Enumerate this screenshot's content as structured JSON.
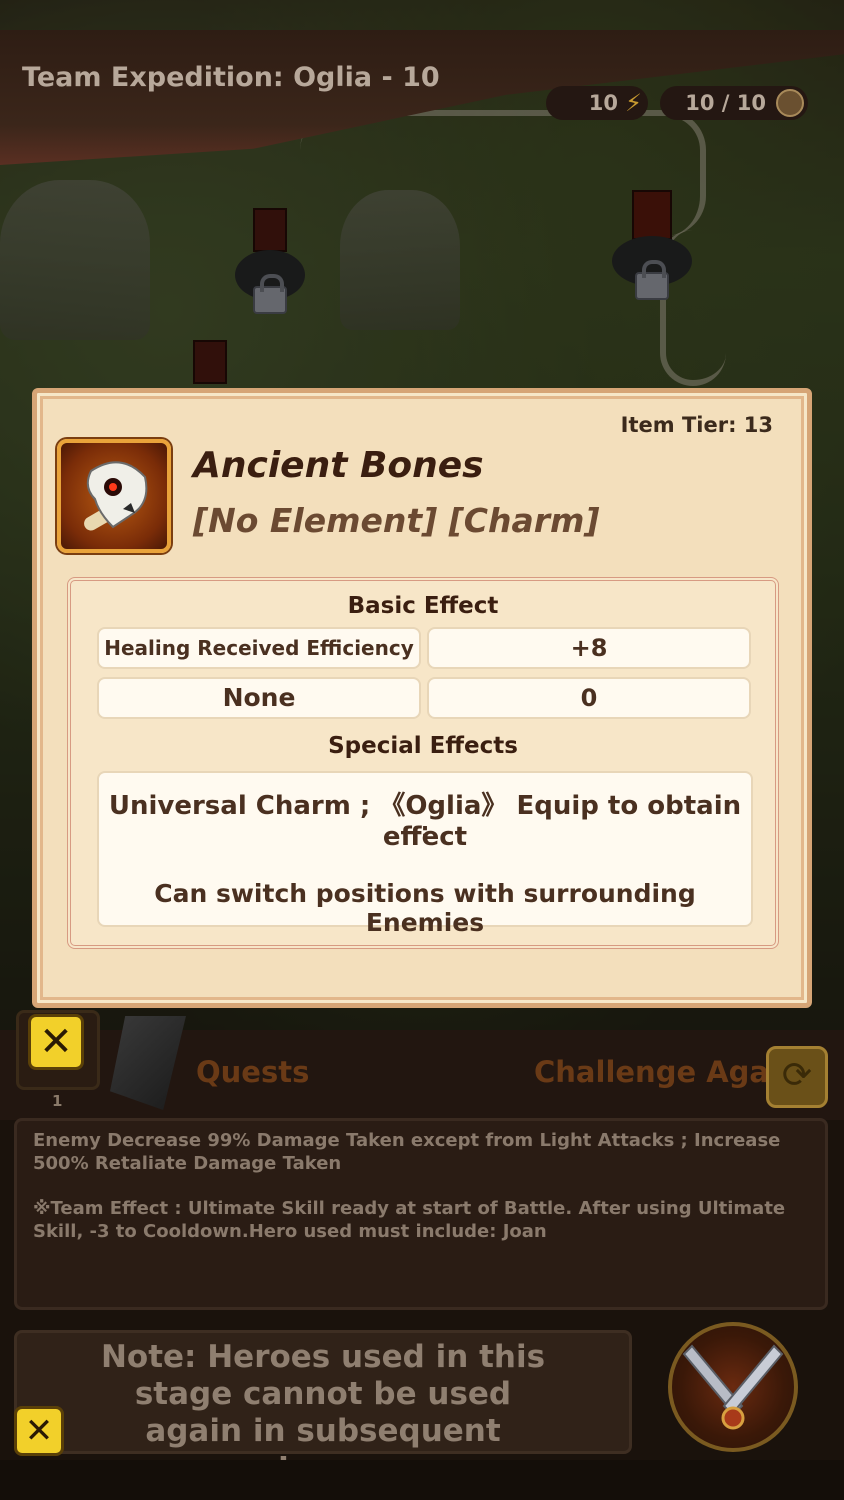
{
  "header": {
    "title": "Team Expedition: Oglia - 10",
    "stamina": "10",
    "attempts": "10 / 10"
  },
  "modal": {
    "item_tier": "Item Tier: 13",
    "item_name": "Ancient Bones",
    "item_type": "[No Element] [Charm]",
    "basic_effect_title": "Basic Effect",
    "basic_effects": [
      {
        "name": "Healing Received Efficiency %",
        "value": "+8"
      },
      {
        "name": "None",
        "value": "0"
      }
    ],
    "special_effects_title": "Special Effects",
    "special_line1": "Universal Charm ; 《Oglia》 Equip to obtain effect",
    "special_line2": ":",
    "special_line3": "Can switch positions with surrounding Enemies"
  },
  "bottom": {
    "quests_label": "Quests",
    "challenge_again_label": "Challenge Again",
    "slot_count": "1",
    "description_1": "Enemy Decrease 99% Damage Taken except from Light Attacks ; Increase 500% Retaliate Damage Taken",
    "description_2": "※Team Effect : Ultimate Skill ready at start of Battle. After using Ultimate Skill, -3 to Cooldown.Hero used must include: Joan",
    "note": "Note: Heroes used in this stage cannot be used again in subsequent stages."
  },
  "icons": [
    "lightning-icon",
    "attempts-icon",
    "lock-icon",
    "skull-bone-icon",
    "close-icon",
    "refresh-icon",
    "battle-swords-icon"
  ],
  "colors": {
    "modal_bg": "#f3dfbc",
    "accent_yellow": "#f2d02a",
    "title_text": "#3a1e10"
  }
}
